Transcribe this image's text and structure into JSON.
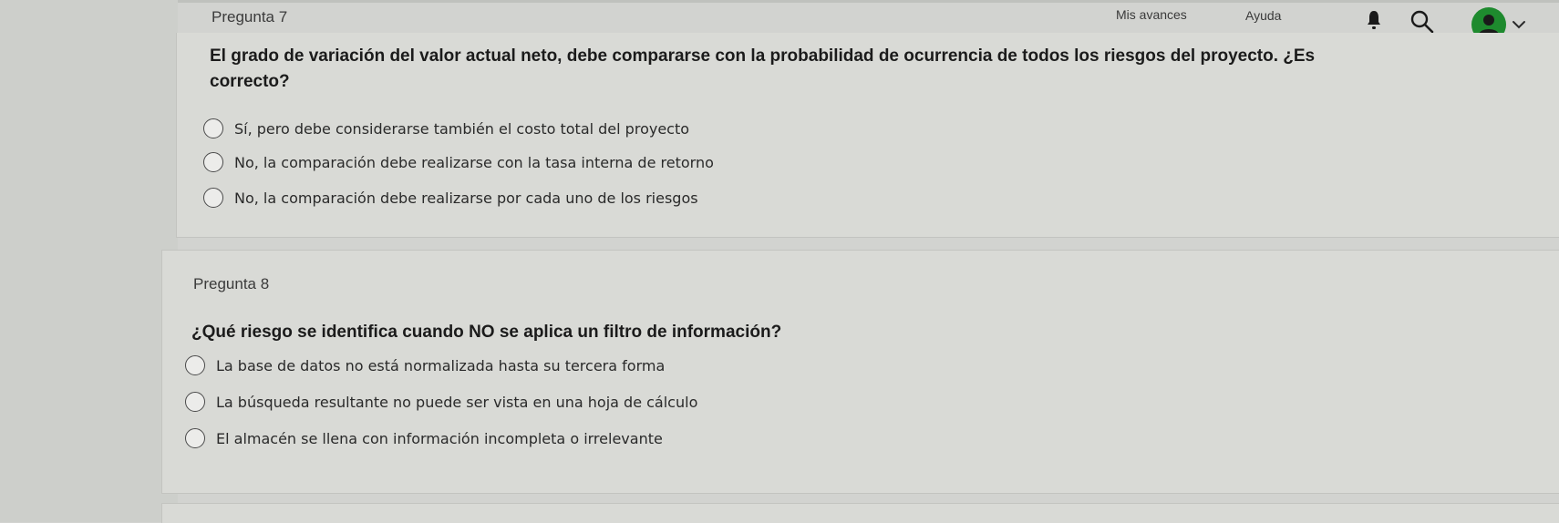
{
  "header": {
    "nav": {
      "progress_label": "Mis avances",
      "help_label": "Ayuda"
    },
    "icons": {
      "notifications": "bell-icon",
      "search": "search-icon",
      "user": "user-avatar-icon",
      "menu": "chevron-down-icon"
    },
    "accent_color": "#1e8a2e"
  },
  "questions": [
    {
      "number_label": "Pregunta 7",
      "text_line1": "El grado de variación del valor actual neto, debe compararse con la probabilidad de ocurrencia de todos los riesgos del proyecto. ¿Es",
      "text_line2": "correcto?",
      "options": [
        "Sí, pero debe considerarse también el costo total del proyecto",
        "No, la comparación debe realizarse con la tasa interna de retorno",
        "No, la comparación debe realizarse por cada uno de los riesgos"
      ]
    },
    {
      "number_label": "Pregunta 8",
      "text_line1": "¿Qué riesgo se identifica cuando NO se aplica un filtro de información?",
      "options": [
        "La base de datos no está normalizada hasta su tercera forma",
        "La búsqueda resultante no puede ser vista en una hoja de cálculo",
        "El almacén se llena con información incompleta o irrelevante"
      ]
    }
  ]
}
